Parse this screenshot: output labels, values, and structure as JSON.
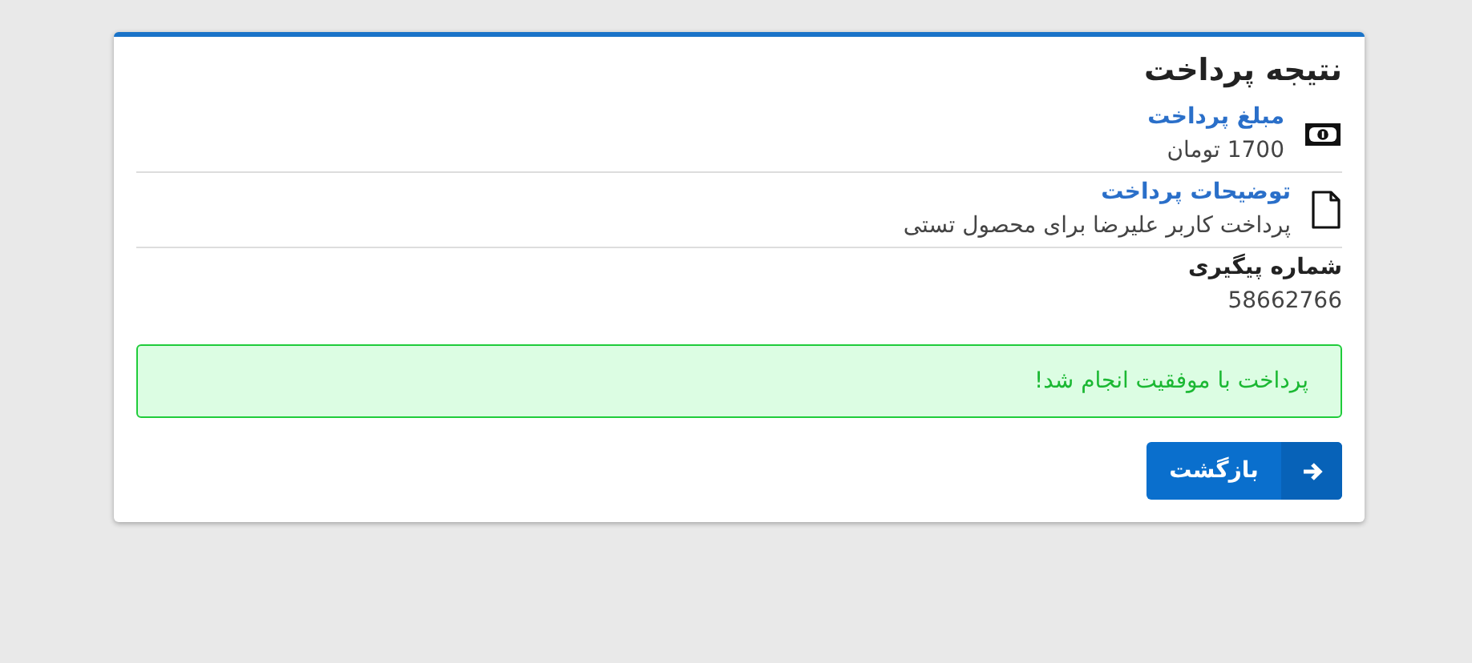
{
  "card": {
    "title": "نتیجه پرداخت",
    "items": [
      {
        "kind": "amount",
        "label": "مبلغ پرداخت",
        "value": "1700 تومان"
      },
      {
        "kind": "description",
        "label": "توضیحات پرداخت",
        "value": "پرداخت کاربر علیرضا برای محصول تستی"
      },
      {
        "kind": "reference",
        "label": "شماره پیگیری",
        "value": "58662766"
      }
    ],
    "alert": {
      "kind": "success",
      "text": "پرداخت با موفقیت انجام شد!"
    },
    "button": {
      "label": "بازگشت"
    }
  }
}
